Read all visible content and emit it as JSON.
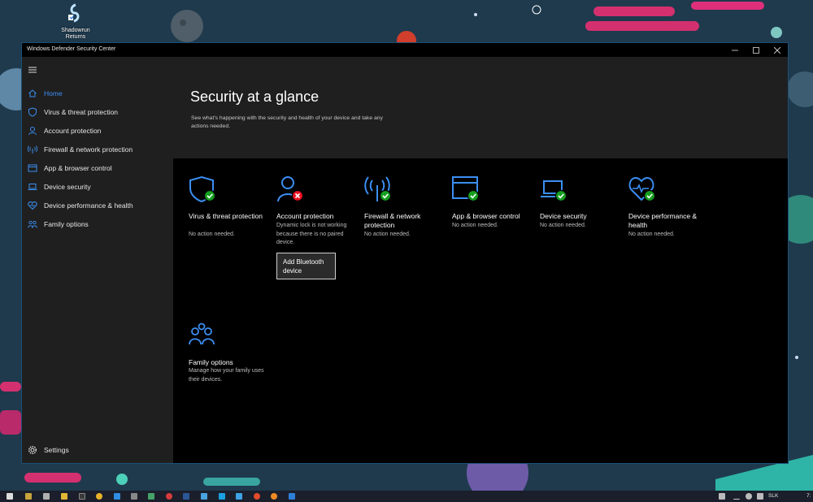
{
  "desktop": {
    "icon_label_line1": "Shadowrun",
    "icon_label_line2": "Returns"
  },
  "window": {
    "title": "Windows Defender Security Center"
  },
  "sidebar": {
    "items": [
      {
        "label": "Home",
        "icon": "home-icon",
        "active": true
      },
      {
        "label": "Virus & threat protection",
        "icon": "shield-icon"
      },
      {
        "label": "Account protection",
        "icon": "person-icon"
      },
      {
        "label": "Firewall & network protection",
        "icon": "wifi-antenna-icon"
      },
      {
        "label": "App & browser control",
        "icon": "app-window-icon"
      },
      {
        "label": "Device security",
        "icon": "laptop-icon"
      },
      {
        "label": "Device performance & health",
        "icon": "heart-icon"
      },
      {
        "label": "Family options",
        "icon": "family-icon"
      }
    ],
    "settings_label": "Settings"
  },
  "header": {
    "title": "Security at a glance",
    "subtitle": "See what's happening with the security and health of your device and take any actions needed."
  },
  "tiles": [
    {
      "title": "Virus & threat protection",
      "status": "No action needed.",
      "state": "ok"
    },
    {
      "title": "Account protection",
      "status": "Dynamic lock is not working because there is no paired device.",
      "state": "error",
      "action": "Add Bluetooth device"
    },
    {
      "title": "Firewall & network protection",
      "status": "No action needed.",
      "state": "ok"
    },
    {
      "title": "App & browser control",
      "status": "No action needed.",
      "state": "ok"
    },
    {
      "title": "Device security",
      "status": "No action needed.",
      "state": "ok"
    },
    {
      "title": "Device performance & health",
      "status": "No action needed.",
      "state": "ok"
    },
    {
      "title": "Family options",
      "status": "Manage how your family uses their devices."
    }
  ],
  "taskbar": {
    "language": "SLK",
    "clock_partial": "7:"
  },
  "colors": {
    "accent": "#3b8ff2",
    "ok_badge": "#16a020",
    "error_badge": "#e81123",
    "sidebar_bg": "#1f1f1f",
    "content_bg": "#000000"
  }
}
